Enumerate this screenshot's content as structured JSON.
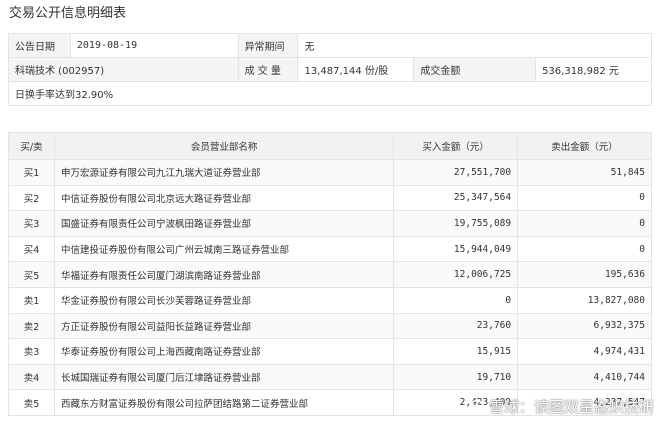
{
  "title": "交易公开信息明细表",
  "info": {
    "date_label": "公告日期",
    "date_value": "2019-08-19",
    "anomaly_label": "异常期间",
    "anomaly_value": "无",
    "stock": "科瑞技术 (002957)",
    "volume_label": "成 交 量",
    "volume_value": "13,487,144 份/股",
    "amount_label": "成交金额",
    "amount_value": "536,318,982 元",
    "turnover": "日换手率达到32.90%"
  },
  "table": {
    "headers": {
      "dir": "买/卖",
      "dept": "会员营业部名称",
      "buy": "买入金额（元）",
      "sell": "卖出金额（元）"
    },
    "rows": [
      {
        "dir": "买1",
        "dept": "申万宏源证券有限公司九江九瑞大道证券营业部",
        "buy": "27,551,700",
        "sell": "51,845"
      },
      {
        "dir": "买2",
        "dept": "中信证券股份有限公司北京远大路证券营业部",
        "buy": "25,347,564",
        "sell": "0"
      },
      {
        "dir": "买3",
        "dept": "国盛证券有限责任公司宁波枫田路证券营业部",
        "buy": "19,755,089",
        "sell": "0"
      },
      {
        "dir": "买4",
        "dept": "中信建投证券股份有限公司广州云城南三路证券营业部",
        "buy": "15,944,049",
        "sell": "0"
      },
      {
        "dir": "买5",
        "dept": "华福证券有限责任公司厦门湖滨南路证券营业部",
        "buy": "12,006,725",
        "sell": "195,636"
      },
      {
        "dir": "卖1",
        "dept": "华金证券股份有限公司长沙芙蓉路证券营业部",
        "buy": "0",
        "sell": "13,827,080"
      },
      {
        "dir": "卖2",
        "dept": "方正证券股份有限公司益阳长益路证券营业部",
        "buy": "23,760",
        "sell": "6,932,375"
      },
      {
        "dir": "卖3",
        "dept": "华泰证券股份有限公司上海西藏南路证券营业部",
        "buy": "15,915",
        "sell": "4,974,431"
      },
      {
        "dir": "卖4",
        "dept": "长城国瑞证券有限公司厦门后江埭路证券营业部",
        "buy": "19,710",
        "sell": "4,410,744"
      },
      {
        "dir": "卖5",
        "dept": "西藏东方财富证券股份有限公司拉萨团结路第二证券营业部",
        "buy": "2,423,409",
        "sell": "4,237,547"
      }
    ]
  },
  "watermark": {
    "icon": "snowball-icon",
    "text": "雪球：读图双星态炽技研"
  }
}
